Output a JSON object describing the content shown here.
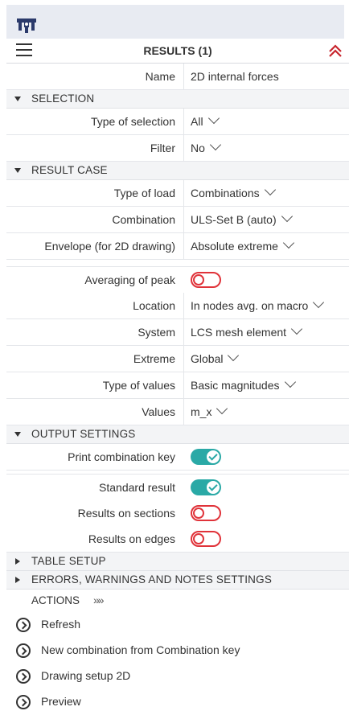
{
  "header": {
    "logo_icon": "scia-logo-icon",
    "title": "RESULTS (1)",
    "menu_icon": "hamburger-icon",
    "collapse_icon": "double-chevron-up-icon"
  },
  "name_row": {
    "label": "Name",
    "value": "2D internal forces"
  },
  "selection": {
    "title": "SELECTION",
    "type_of_selection": {
      "label": "Type of selection",
      "value": "All"
    },
    "filter": {
      "label": "Filter",
      "value": "No"
    }
  },
  "result_case": {
    "title": "RESULT CASE",
    "type_of_load": {
      "label": "Type of load",
      "value": "Combinations"
    },
    "combination": {
      "label": "Combination",
      "value": "ULS-Set B (auto)"
    },
    "envelope": {
      "label": "Envelope (for 2D drawing)",
      "value": "Absolute extreme"
    }
  },
  "params": {
    "averaging": {
      "label": "Averaging of peak",
      "on": false
    },
    "location": {
      "label": "Location",
      "value": "In nodes avg. on macro"
    },
    "system": {
      "label": "System",
      "value": "LCS mesh element"
    },
    "extreme": {
      "label": "Extreme",
      "value": "Global"
    },
    "type_of_values": {
      "label": "Type of values",
      "value": "Basic magnitudes"
    },
    "values": {
      "label": "Values",
      "value": "m_x"
    }
  },
  "output": {
    "title": "OUTPUT SETTINGS",
    "print_key": {
      "label": "Print combination key",
      "on": true
    },
    "standard_result": {
      "label": "Standard result",
      "on": true
    },
    "results_sections": {
      "label": "Results on sections",
      "on": false
    },
    "results_edges": {
      "label": "Results on edges",
      "on": false
    }
  },
  "table_setup": {
    "title": "TABLE SETUP"
  },
  "errors": {
    "title": "ERRORS, WARNINGS AND NOTES SETTINGS"
  },
  "actions": {
    "title": "ACTIONS",
    "more": "»»",
    "items": [
      "Refresh",
      "New combination from Combination key",
      "Drawing setup 2D",
      "Preview"
    ]
  },
  "colors": {
    "toggle_on": "#2aa9a6",
    "toggle_off": "#e0333a",
    "brand": "#2b3a6b"
  }
}
